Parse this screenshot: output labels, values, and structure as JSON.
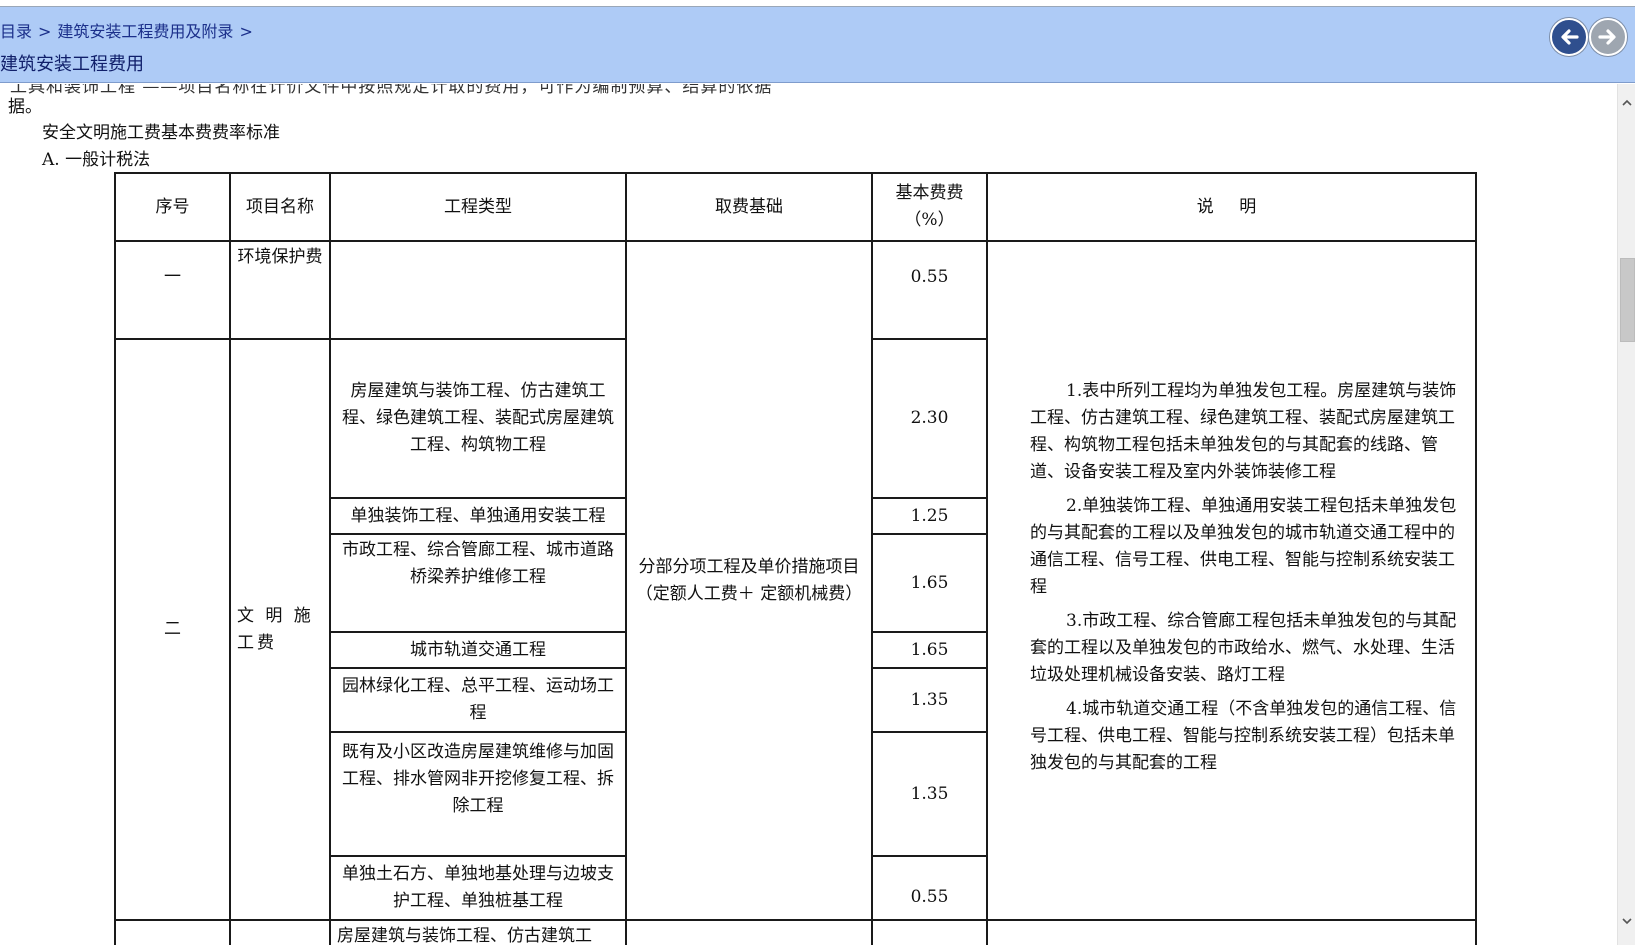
{
  "breadcrumb": {
    "item1": "目录",
    "item2": "建筑安装工程费用及附录",
    "separator": ">"
  },
  "header": {
    "title": "建筑安装工程费用"
  },
  "nav": {
    "back_icon": "arrow-left-icon",
    "forward_icon": "arrow-right-icon"
  },
  "body": {
    "cut_text": "工具和装饰工程        ——项目名称在计价文件中按照规定计取的费用，可作为编制预算、结算的依据",
    "ju": "据。",
    "section_title": "安全文明施工费基本费费率标准",
    "method": "A. 一般计税法"
  },
  "table": {
    "headers": {
      "no": "序号",
      "name": "项目名称",
      "type": "工程类型",
      "basis": "取费基础",
      "rate": "基本费费（%）",
      "notes": "说 明"
    },
    "rows": [
      {
        "no": "一",
        "name": "环境保护费",
        "type": "",
        "rate": "0.55"
      },
      {
        "no": "二",
        "name": "文 明 施 工费",
        "type": "房屋建筑与装饰工程、仿古建筑工程、绿色建筑工程、装配式房屋建筑工程、构筑物工程",
        "rate": "2.30"
      },
      {
        "type": "单独装饰工程、单独通用安装工程",
        "rate": "1.25"
      },
      {
        "type": "市政工程、综合管廊工程、城市道路桥梁养护维修工程",
        "rate": "1.65"
      },
      {
        "type": "城市轨道交通工程",
        "rate": "1.65"
      },
      {
        "type": "园林绿化工程、总平工程、运动场工程",
        "rate": "1.35"
      },
      {
        "type": "既有及小区改造房屋建筑维修与加固工程、排水管网非开挖修复工程、拆除工程",
        "rate": "1.35"
      },
      {
        "type": "单独土石方、单独地基处理与边坡支护工程、单独桩基工程",
        "rate": "0.55"
      }
    ],
    "next_row_type": "房屋建筑与装饰工程、仿古建筑工",
    "basis_text": "分部分项工程及单价措施项目（定额人工费＋ 定额机械费）",
    "notes": [
      "1.表中所列工程均为单独发包工程。房屋建筑与装饰工程、仿古建筑工程、绿色建筑工程、装配式房屋建筑工程、构筑物工程包括未单独发包的与其配套的线路、管道、设备安装工程及室内外装饰装修工程",
      "2.单独装饰工程、单独通用安装工程包括未单独发包的与其配套的工程以及单独发包的城市轨道交通工程中的通信工程、信号工程、供电工程、智能与控制系统安装工程",
      "3.市政工程、综合管廊工程包括未单独发包的与其配套的工程以及单独发包的市政给水、燃气、水处理、生活垃圾处理机械设备安装、路灯工程",
      "4.城市轨道交通工程（不含单独发包的通信工程、信号工程、供电工程、智能与控制系统安装工程）包括未单独发包的与其配套的工程"
    ]
  },
  "scrollbar": {
    "up_icon": "chevron-up-icon",
    "down_icon": "chevron-down-icon"
  }
}
